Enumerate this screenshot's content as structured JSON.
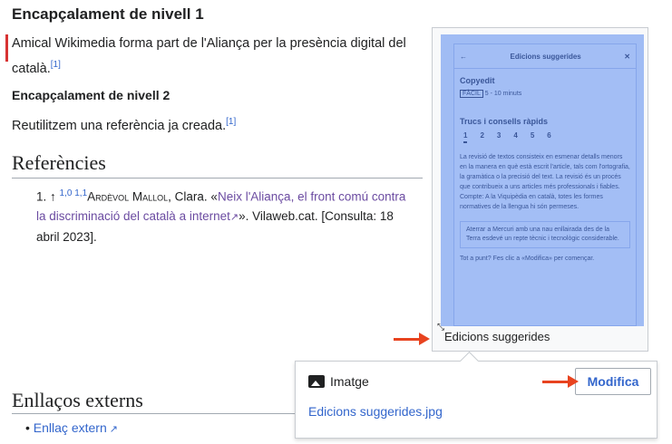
{
  "article": {
    "h1": "Encapçalament de nivell 1",
    "p1": "Amical Wikimedia forma part de l'Aliança per la presència digital del català.",
    "p1_ref": "[1]",
    "h2": "Encapçalament de nivell 2",
    "p2": "Reutilitzem una referència ja creada.",
    "p2_ref": "[1]"
  },
  "references": {
    "heading": "Referències",
    "item_number": "1.",
    "up_arrow": "↑",
    "backlinks": "1,0 1,1",
    "author": "Ardèvol Mallol",
    "author_rest": ", Clara. «",
    "link": "Neix l'Aliança, el front comú contra la discriminació del català a internet",
    "rest": "». Vilaweb.cat. [Consulta: 18 abril 2023]."
  },
  "external": {
    "heading": "Enllaços externs",
    "link": "Enllaç extern"
  },
  "thumbnail": {
    "caption": "Edicions suggerides",
    "card": {
      "title": "Edicions suggerides",
      "task": "Copyedit",
      "badge": "FÀCIL",
      "time": "5 - 10 minuts",
      "tips_title": "Trucs i consells ràpids",
      "tabs": [
        "1",
        "2",
        "3",
        "4",
        "5",
        "6"
      ],
      "body": "La revisió de textos consisteix en esmenar detalls menors en la manera en què està escrit l'article, tals com l'ortografia, la gramàtica o la precisió del text. La revisió és un procés que contribueix a uns articles més professionals i fiables. Compte: A la Viquipèdia en català, totes les formes normatives de la llengua hi són permeses.",
      "quote": "Aterrar a Mercuri amb una nau enllairada des de la Terra esdevé un repte tècnic i tecnològic considerable.",
      "footer": "Tot a punt? Fes clic a «Modifica» per començar."
    }
  },
  "popup": {
    "type_label": "Imatge",
    "edit_button": "Modifica",
    "filename": "Edicions suggerides.jpg"
  },
  "colors": {
    "link": "#6b4ba1",
    "accent": "#3366cc",
    "arrow": "#e8431f"
  }
}
